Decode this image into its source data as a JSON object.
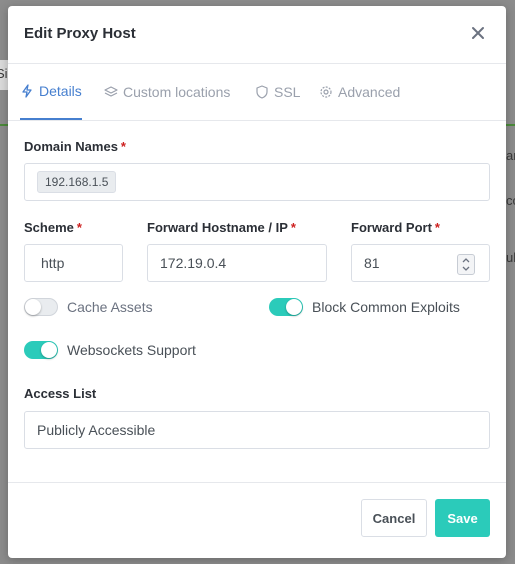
{
  "background": {
    "fragment_left": "Si",
    "fragment_right_1": "ar",
    "fragment_right_2": "co",
    "fragment_right_3": "ul"
  },
  "modal": {
    "title": "Edit Proxy Host",
    "close_icon": "close-icon"
  },
  "tabs": [
    {
      "label": "Details",
      "icon": "bolt-icon",
      "active": true
    },
    {
      "label": "Custom locations",
      "icon": "layers-icon",
      "active": false
    },
    {
      "label": "SSL",
      "icon": "shield-icon",
      "active": false
    },
    {
      "label": "Advanced",
      "icon": "gear-icon",
      "active": false
    }
  ],
  "form": {
    "domain_names": {
      "label": "Domain Names",
      "required_mark": "*",
      "tags": [
        "192.168.1.5"
      ]
    },
    "scheme": {
      "label": "Scheme",
      "required_mark": "*",
      "value": "http"
    },
    "forward_host": {
      "label": "Forward Hostname / IP",
      "required_mark": "*",
      "value": "172.19.0.4"
    },
    "forward_port": {
      "label": "Forward Port",
      "required_mark": "*",
      "value": "81"
    },
    "toggles": [
      {
        "label": "Cache Assets",
        "on": false
      },
      {
        "label": "Block Common Exploits",
        "on": true
      },
      {
        "label": "Websockets Support",
        "on": true
      }
    ],
    "access_list": {
      "label": "Access List",
      "value": "Publicly Accessible"
    }
  },
  "footer": {
    "cancel_label": "Cancel",
    "save_label": "Save"
  },
  "colors": {
    "accent_teal": "#2bcbba",
    "tab_active_blue": "#467fcf",
    "required_red": "#cd201f"
  }
}
